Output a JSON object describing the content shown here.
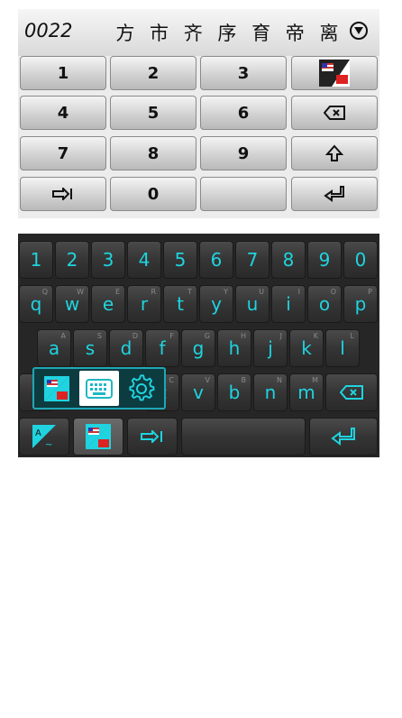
{
  "candidates": {
    "code": "0022",
    "items": [
      "方",
      "市",
      "齐",
      "序",
      "育",
      "帝",
      "离"
    ],
    "expand_icon": "chevron-down-circle-icon"
  },
  "numpad": {
    "rows": [
      [
        {
          "label": "1"
        },
        {
          "label": "2"
        },
        {
          "label": "3"
        },
        {
          "icon": "lang-switch-flag-icon"
        }
      ],
      [
        {
          "label": "4"
        },
        {
          "label": "5"
        },
        {
          "label": "6"
        },
        {
          "icon": "backspace-icon"
        }
      ],
      [
        {
          "label": "7"
        },
        {
          "label": "8"
        },
        {
          "label": "9"
        },
        {
          "icon": "shift-icon"
        }
      ],
      [
        {
          "icon": "tab-icon"
        },
        {
          "label": "0"
        },
        {
          "label": ""
        },
        {
          "icon": "enter-icon"
        }
      ]
    ]
  },
  "keyboard": {
    "digits": [
      "1",
      "2",
      "3",
      "4",
      "5",
      "6",
      "7",
      "8",
      "9",
      "0"
    ],
    "row1": [
      {
        "label": "q",
        "sub": "Q"
      },
      {
        "label": "w",
        "sub": "W"
      },
      {
        "label": "e",
        "sub": "E"
      },
      {
        "label": "r",
        "sub": "R"
      },
      {
        "label": "t",
        "sub": "T"
      },
      {
        "label": "y",
        "sub": "Y"
      },
      {
        "label": "u",
        "sub": "U"
      },
      {
        "label": "i",
        "sub": "I"
      },
      {
        "label": "o",
        "sub": "O"
      },
      {
        "label": "p",
        "sub": "P"
      }
    ],
    "row2": [
      {
        "label": "a",
        "sub": "A"
      },
      {
        "label": "s",
        "sub": "S"
      },
      {
        "label": "d",
        "sub": "D"
      },
      {
        "label": "f",
        "sub": "F"
      },
      {
        "label": "g",
        "sub": "G"
      },
      {
        "label": "h",
        "sub": "H"
      },
      {
        "label": "j",
        "sub": "J"
      },
      {
        "label": "k",
        "sub": "K"
      },
      {
        "label": "l",
        "sub": "L"
      }
    ],
    "row3": [
      {
        "label": "c",
        "sub": "C"
      },
      {
        "label": "v",
        "sub": "V"
      },
      {
        "label": "b",
        "sub": "B"
      },
      {
        "label": "n",
        "sub": "N"
      },
      {
        "label": "m",
        "sub": "M"
      }
    ],
    "accent_color": "#1fd4e0"
  },
  "popup": {
    "options": [
      "lang-flag-icon",
      "keyboard-icon",
      "settings-gear-icon"
    ],
    "selected": "keyboard-icon"
  }
}
